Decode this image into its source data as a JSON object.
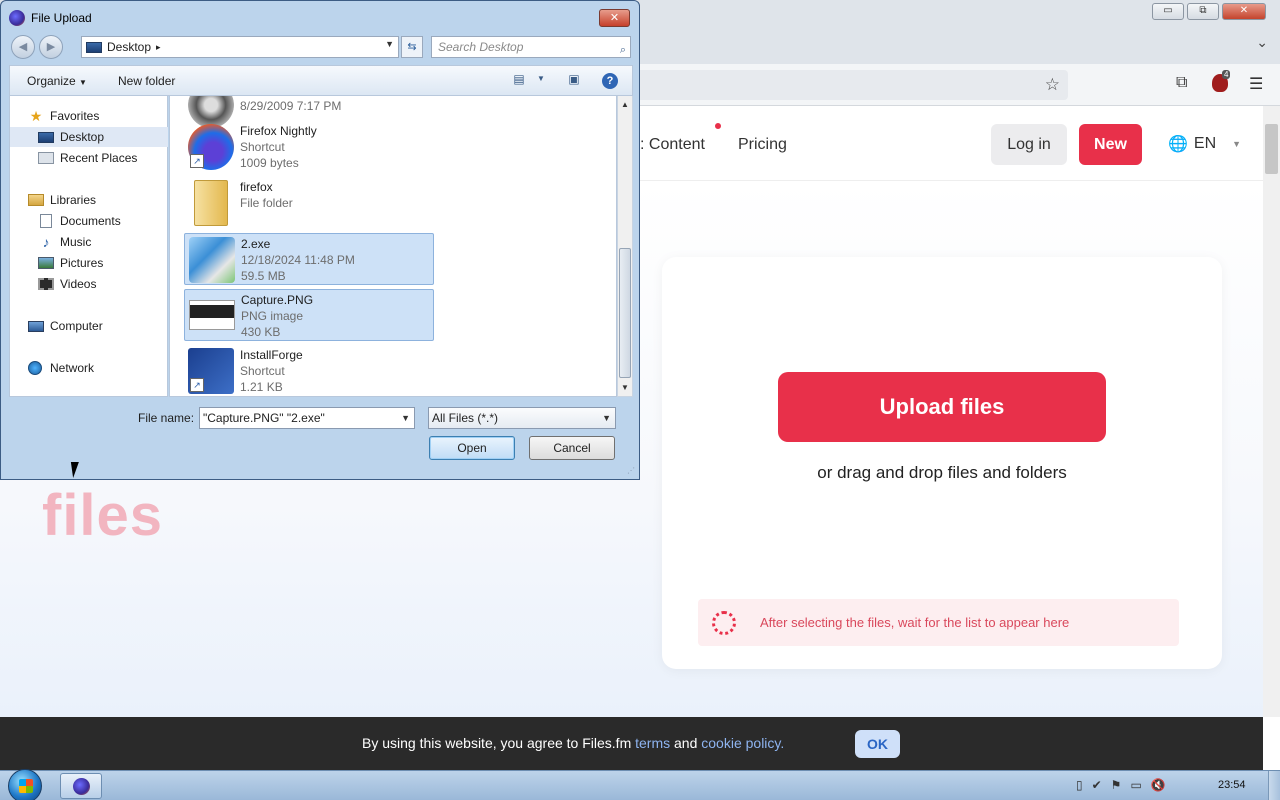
{
  "browser": {
    "window_controls": {
      "minimize": "▭",
      "restore": "⧉",
      "close": "✕"
    },
    "extension_badge_count": "4"
  },
  "site": {
    "nav": {
      "content_label": "Content",
      "pricing_label": "Pricing",
      "login_label": "Log in",
      "new_label": "New",
      "lang_label": "EN"
    },
    "hero_word": "files",
    "upload": {
      "button_label": "Upload files",
      "drag_text": "or drag and drop files and folders",
      "info_text": "After selecting the files, wait for the list to appear here"
    },
    "cookie": {
      "text_before": "By using this website, you agree to Files.fm",
      "terms_link": "terms",
      "and_text": "and",
      "policy_link": "cookie policy.",
      "ok_label": "OK"
    },
    "accent_color": "#e8304a"
  },
  "dialog": {
    "title": "File Upload",
    "close_label": "✕",
    "address": {
      "location": "Desktop",
      "separator": "▸"
    },
    "search_placeholder": "Search Desktop",
    "toolbar": {
      "organize_label": "Organize",
      "new_folder_label": "New folder",
      "help_label": "?"
    },
    "nav_pane": {
      "favorites": "Favorites",
      "desktop": "Desktop",
      "recent_places": "Recent Places",
      "libraries": "Libraries",
      "documents": "Documents",
      "music": "Music",
      "pictures": "Pictures",
      "videos": "Videos",
      "computer": "Computer",
      "network": "Network"
    },
    "files": [
      {
        "name": "",
        "line1": "8/29/2009 7:17 PM",
        "line2": "",
        "icon": "disc-icon"
      },
      {
        "name": "Firefox Nightly",
        "line1": "Shortcut",
        "line2": "1009 bytes",
        "icon": "firefox-nightly-icon"
      },
      {
        "name": "firefox",
        "line1": "File folder",
        "line2": "",
        "icon": "folder-icon"
      },
      {
        "name": "2.exe",
        "line1": "12/18/2024 11:48 PM",
        "line2": "59.5 MB",
        "icon": "setup-exe-icon",
        "selected": true
      },
      {
        "name": "Capture.PNG",
        "line1": "PNG image",
        "line2": "430 KB",
        "icon": "png-thumbnail-icon",
        "selected": true
      },
      {
        "name": "InstallForge",
        "line1": "Shortcut",
        "line2": "1.21 KB",
        "icon": "installforge-icon"
      }
    ],
    "file_name_label": "File name:",
    "file_name_value": "\"Capture.PNG\" \"2.exe\"",
    "file_type_value": "All Files (*.*)",
    "open_label": "Open",
    "cancel_label": "Cancel"
  },
  "taskbar": {
    "clock": "23:54"
  }
}
